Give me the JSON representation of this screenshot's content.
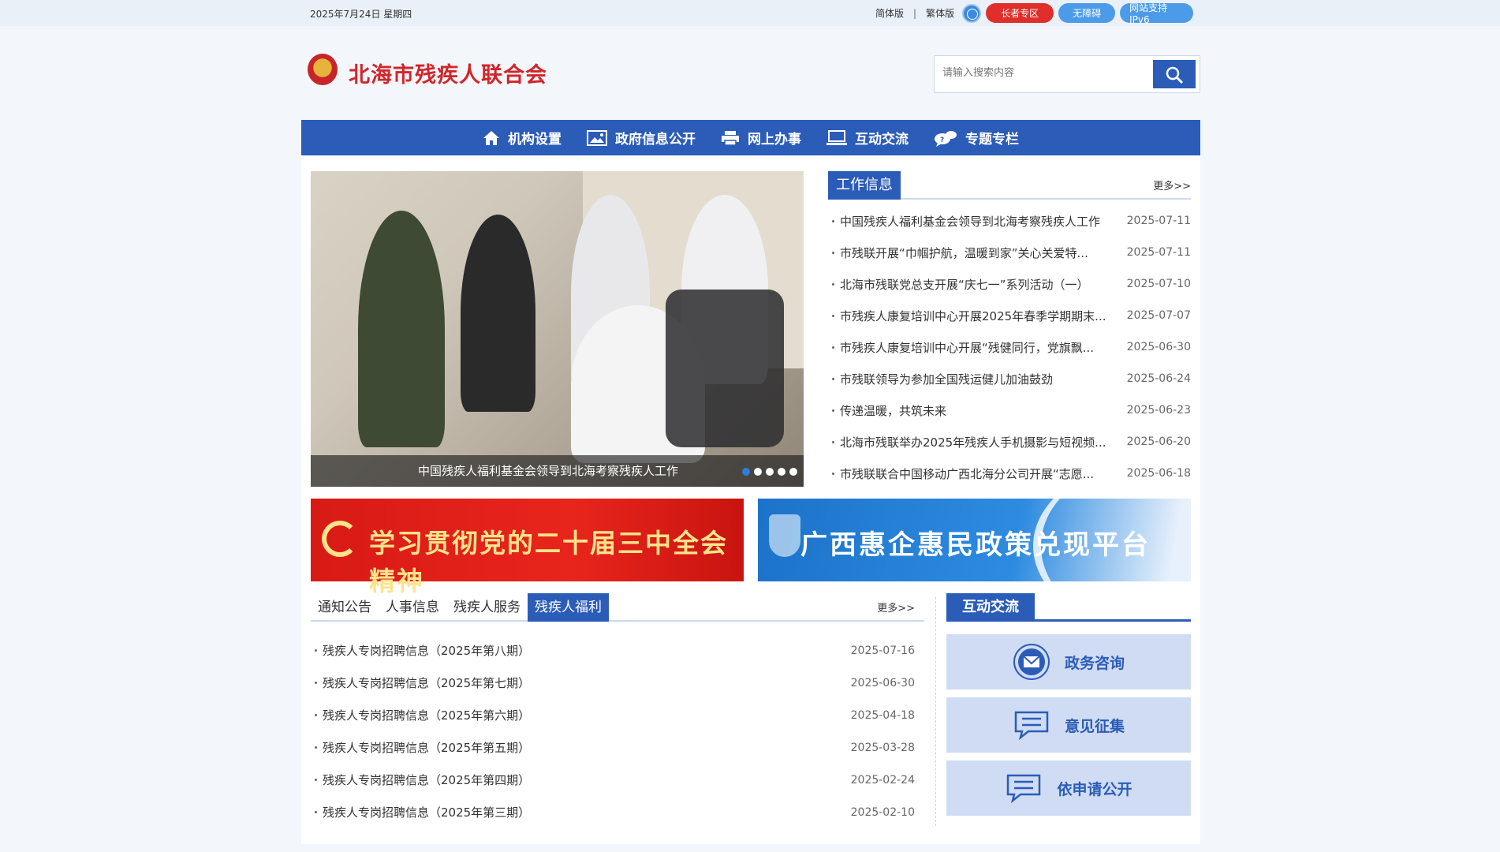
{
  "topbar": {
    "date": "2025年7月24日 星期四",
    "simplified": "简体版",
    "separator": "|",
    "traditional": "繁体版",
    "elder_zone": "长者专区",
    "accessibility": "无障碍",
    "ipv6": "网站支持IPv6"
  },
  "header": {
    "site_title": "北海市残疾人联合会",
    "search_placeholder": "请输入搜索内容"
  },
  "nav": [
    {
      "label": "机构设置",
      "icon": "home-icon"
    },
    {
      "label": "政府信息公开",
      "icon": "picture-icon"
    },
    {
      "label": "网上办事",
      "icon": "printer-icon"
    },
    {
      "label": "互动交流",
      "icon": "monitor-icon"
    },
    {
      "label": "专题专栏",
      "icon": "chat-icon"
    }
  ],
  "carousel": {
    "caption": "中国残疾人福利基金会领导到北海考察残疾人工作",
    "slides": 5,
    "active_slide": 1
  },
  "work_news": {
    "title": "工作信息",
    "more": "更多>>",
    "items": [
      {
        "title": "中国残疾人福利基金会领导到北海考察残疾人工作",
        "date": "2025-07-11"
      },
      {
        "title": "市残联开展“巾帼护航，温暖到家”关心关爱特...",
        "date": "2025-07-11"
      },
      {
        "title": "北海市残联党总支开展“庆七一”系列活动（一）",
        "date": "2025-07-10"
      },
      {
        "title": "市残疾人康复培训中心开展2025年春季学期期末...",
        "date": "2025-07-07"
      },
      {
        "title": "市残疾人康复培训中心开展“残健同行，党旗飘...",
        "date": "2025-06-30"
      },
      {
        "title": "市残联领导为参加全国残运健儿加油鼓劲",
        "date": "2025-06-24"
      },
      {
        "title": "传递温暖，共筑未来",
        "date": "2025-06-23"
      },
      {
        "title": "北海市残联举办2025年残疾人手机摄影与短视频...",
        "date": "2025-06-20"
      },
      {
        "title": "市残联联合中国移动广西北海分公司开展“志愿...",
        "date": "2025-06-18"
      }
    ]
  },
  "banners": {
    "left": "学习贯彻党的二十届三中全会精神",
    "right": "广西惠企惠民政策兑现平台"
  },
  "tabs_panel": {
    "tabs": [
      "通知公告",
      "人事信息",
      "残疾人服务",
      "残疾人福利"
    ],
    "active_tab": 3,
    "more": "更多>>",
    "items": [
      {
        "title": "残疾人专岗招聘信息（2025年第八期）",
        "date": "2025-07-16"
      },
      {
        "title": "残疾人专岗招聘信息（2025年第七期）",
        "date": "2025-06-30"
      },
      {
        "title": "残疾人专岗招聘信息（2025年第六期）",
        "date": "2025-04-18"
      },
      {
        "title": "残疾人专岗招聘信息（2025年第五期）",
        "date": "2025-03-28"
      },
      {
        "title": "残疾人专岗招聘信息（2025年第四期）",
        "date": "2025-02-24"
      },
      {
        "title": "残疾人专岗招聘信息（2025年第三期）",
        "date": "2025-02-10"
      }
    ]
  },
  "interact": {
    "title": "互动交流",
    "buttons": [
      {
        "label": "政务咨询",
        "icon": "mail-icon"
      },
      {
        "label": "意见征集",
        "icon": "message-icon"
      },
      {
        "label": "依申请公开",
        "icon": "message-icon"
      }
    ]
  },
  "colors": {
    "primary": "#2b5cb7",
    "accent_red": "#d1262b",
    "light_panel": "#cfdcf3"
  }
}
